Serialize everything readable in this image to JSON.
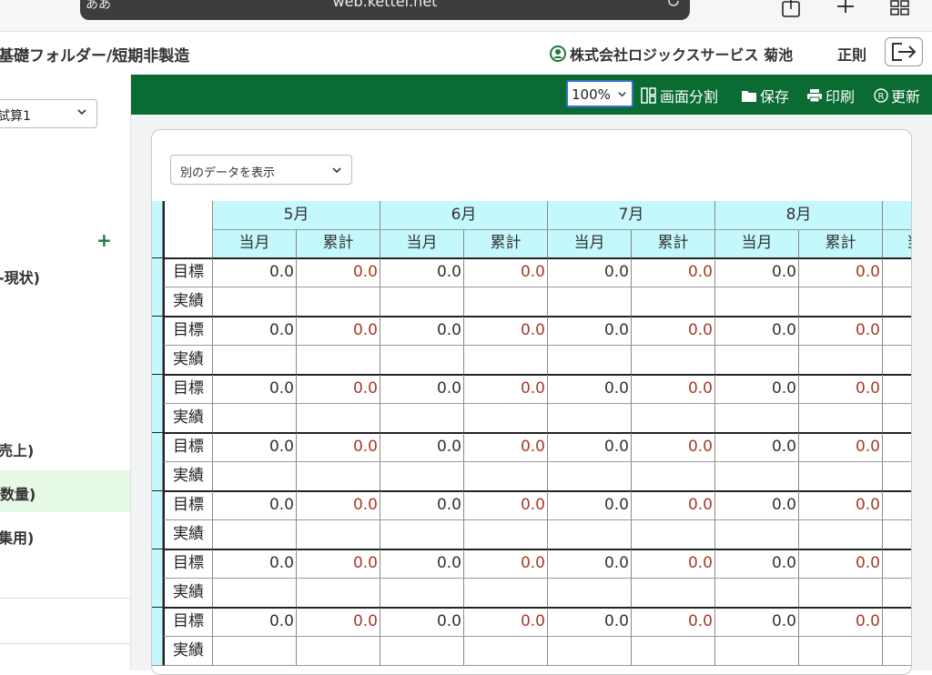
{
  "browser": {
    "aa_label": "ああ",
    "url": "web.kettel.net"
  },
  "header": {
    "breadcrumb": "基礎フォルダー/短期非製造",
    "company_user": "株式会社ロジックスサービス 菊池",
    "role": "正則"
  },
  "sidebar": {
    "select_value": "試算1",
    "plus": "+",
    "items": [
      {
        "label": "-現状)",
        "active": false
      },
      {
        "label": "売上)",
        "active": false
      },
      {
        "label": "数量)",
        "active": true
      },
      {
        "label": "集用)",
        "active": false
      }
    ]
  },
  "toolbar": {
    "zoom": "100%",
    "split_label": "画面分割",
    "save_label": "保存",
    "print_label": "印刷",
    "refresh_label": "更新"
  },
  "main": {
    "data_select_value": "別のデータを表示",
    "months": [
      "5月",
      "6月",
      "7月",
      "8月"
    ],
    "sub_headers": [
      "当月",
      "累計"
    ],
    "partial_next_sub": "当",
    "row_labels": {
      "target": "目標",
      "actual": "実績"
    },
    "groups": [
      {
        "target": [
          "0.0",
          "0.0",
          "0.0",
          "0.0",
          "0.0",
          "0.0",
          "0.0",
          "0.0"
        ]
      },
      {
        "target": [
          "0.0",
          "0.0",
          "0.0",
          "0.0",
          "0.0",
          "0.0",
          "0.0",
          "0.0"
        ]
      },
      {
        "target": [
          "0.0",
          "0.0",
          "0.0",
          "0.0",
          "0.0",
          "0.0",
          "0.0",
          "0.0"
        ]
      },
      {
        "target": [
          "0.0",
          "0.0",
          "0.0",
          "0.0",
          "0.0",
          "0.0",
          "0.0",
          "0.0"
        ]
      },
      {
        "target": [
          "0.0",
          "0.0",
          "0.0",
          "0.0",
          "0.0",
          "0.0",
          "0.0",
          "0.0"
        ]
      },
      {
        "target": [
          "0.0",
          "0.0",
          "0.0",
          "0.0",
          "0.0",
          "0.0",
          "0.0",
          "0.0"
        ]
      },
      {
        "target": [
          "0.0",
          "0.0",
          "0.0",
          "0.0",
          "0.0",
          "0.0",
          "0.0",
          "0.0"
        ]
      }
    ]
  },
  "colors": {
    "toolbar_green": "#0a6b33",
    "header_cyan": "#c4f8fc",
    "cumulative_red": "#a83a2a",
    "active_sidebar": "#e6f9e6"
  }
}
